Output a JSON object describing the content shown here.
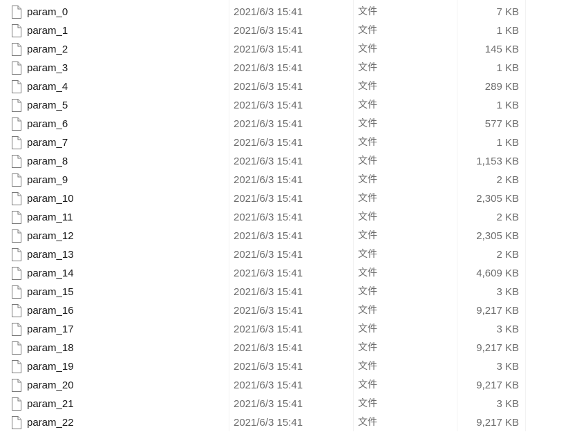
{
  "files": [
    {
      "name": "param_0",
      "modified": "2021/6/3 15:41",
      "type": "文件",
      "size": "7 KB"
    },
    {
      "name": "param_1",
      "modified": "2021/6/3 15:41",
      "type": "文件",
      "size": "1 KB"
    },
    {
      "name": "param_2",
      "modified": "2021/6/3 15:41",
      "type": "文件",
      "size": "145 KB"
    },
    {
      "name": "param_3",
      "modified": "2021/6/3 15:41",
      "type": "文件",
      "size": "1 KB"
    },
    {
      "name": "param_4",
      "modified": "2021/6/3 15:41",
      "type": "文件",
      "size": "289 KB"
    },
    {
      "name": "param_5",
      "modified": "2021/6/3 15:41",
      "type": "文件",
      "size": "1 KB"
    },
    {
      "name": "param_6",
      "modified": "2021/6/3 15:41",
      "type": "文件",
      "size": "577 KB"
    },
    {
      "name": "param_7",
      "modified": "2021/6/3 15:41",
      "type": "文件",
      "size": "1 KB"
    },
    {
      "name": "param_8",
      "modified": "2021/6/3 15:41",
      "type": "文件",
      "size": "1,153 KB"
    },
    {
      "name": "param_9",
      "modified": "2021/6/3 15:41",
      "type": "文件",
      "size": "2 KB"
    },
    {
      "name": "param_10",
      "modified": "2021/6/3 15:41",
      "type": "文件",
      "size": "2,305 KB"
    },
    {
      "name": "param_11",
      "modified": "2021/6/3 15:41",
      "type": "文件",
      "size": "2 KB"
    },
    {
      "name": "param_12",
      "modified": "2021/6/3 15:41",
      "type": "文件",
      "size": "2,305 KB"
    },
    {
      "name": "param_13",
      "modified": "2021/6/3 15:41",
      "type": "文件",
      "size": "2 KB"
    },
    {
      "name": "param_14",
      "modified": "2021/6/3 15:41",
      "type": "文件",
      "size": "4,609 KB"
    },
    {
      "name": "param_15",
      "modified": "2021/6/3 15:41",
      "type": "文件",
      "size": "3 KB"
    },
    {
      "name": "param_16",
      "modified": "2021/6/3 15:41",
      "type": "文件",
      "size": "9,217 KB"
    },
    {
      "name": "param_17",
      "modified": "2021/6/3 15:41",
      "type": "文件",
      "size": "3 KB"
    },
    {
      "name": "param_18",
      "modified": "2021/6/3 15:41",
      "type": "文件",
      "size": "9,217 KB"
    },
    {
      "name": "param_19",
      "modified": "2021/6/3 15:41",
      "type": "文件",
      "size": "3 KB"
    },
    {
      "name": "param_20",
      "modified": "2021/6/3 15:41",
      "type": "文件",
      "size": "9,217 KB"
    },
    {
      "name": "param_21",
      "modified": "2021/6/3 15:41",
      "type": "文件",
      "size": "3 KB"
    },
    {
      "name": "param_22",
      "modified": "2021/6/3 15:41",
      "type": "文件",
      "size": "9,217 KB"
    }
  ],
  "icons": {
    "file": "generic-file-icon"
  },
  "colors": {
    "name_text": "#1a1a1a",
    "detail_text": "#6d6d6d",
    "icon_stroke": "#7a7a7a",
    "hover_background": "#e5f3ff"
  }
}
